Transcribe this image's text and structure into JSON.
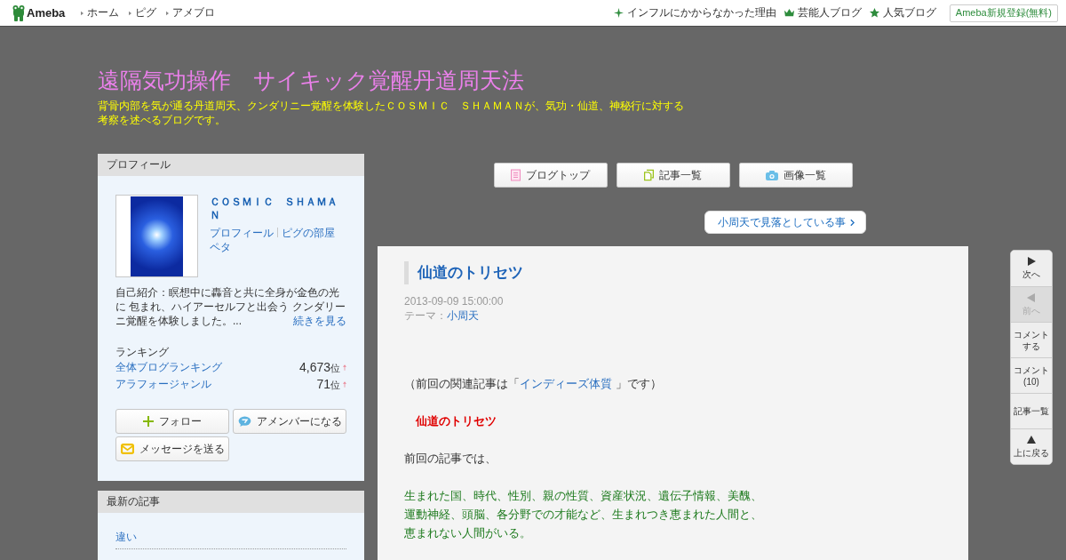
{
  "top_bar": {
    "logo": "Ameba",
    "nav": [
      "ホーム",
      "ピグ",
      "アメブロ"
    ],
    "links": [
      {
        "kind": "sparkle",
        "label": "インフルにかからなかった理由"
      },
      {
        "kind": "crown",
        "label": "芸能人ブログ"
      },
      {
        "kind": "star",
        "label": "人気ブログ"
      }
    ],
    "signup_button": "Ameba新規登録(無料)"
  },
  "blog_header": {
    "title": "遠隔気功操作　サイキック覚醒丹道周天法",
    "description": "背骨内部を気が通る丹道周天、クンダリニー覚醒を体験したＣＯＳＭＩＣ　ＳＨＡＭＡＮが、気功・仙道、神秘行に対する考察を述べるブログです。"
  },
  "profile": {
    "heading": "プロフィール",
    "name": "ＣＯＳＭＩＣ　ＳＨＡＭＡＮ",
    "links": [
      "プロフィール",
      "ピグの部屋",
      "ペタ"
    ],
    "intro": "自己紹介：瞑想中に轟音と共に全身が金色の光に 包まれ、ハイアーセルフと出会う クンダリーニ覚醒を体験しました。...",
    "more_link": "続きを見る",
    "ranking_heading": "ランキング",
    "rankings": [
      {
        "label": "全体ブログランキング",
        "rank": "4,673",
        "unit": "位",
        "rising": true
      },
      {
        "label": "アラフォージャンル",
        "rank": "71",
        "unit": "位",
        "rising": true
      }
    ],
    "buttons": [
      {
        "kind": "follow",
        "label": "フォロー"
      },
      {
        "kind": "amember",
        "label": "アメンバーになる"
      },
      {
        "kind": "message",
        "label": "メッセージを送る"
      }
    ]
  },
  "latest_entries": {
    "heading": "最新の記事",
    "items": [
      "違い"
    ]
  },
  "blog_nav": [
    {
      "kind": "top",
      "label": "ブログトップ"
    },
    {
      "kind": "entries",
      "label": "記事一覧"
    },
    {
      "kind": "images",
      "label": "画像一覧"
    }
  ],
  "next_entry_link": "小周天で見落としている事",
  "article": {
    "title": "仙道のトリセツ",
    "date": "2013-09-09 15:00:00",
    "theme_label": "テーマ：",
    "theme": "小周天",
    "body": [
      {
        "kind": "related",
        "before": "（前回の関連記事は「",
        "link": "インディーズ体質",
        "after": " 」です）"
      },
      {
        "kind": "heading",
        "text": "仙道のトリセツ"
      },
      {
        "kind": "plain",
        "text": "前回の記事では、"
      },
      {
        "kind": "highlight",
        "lines": [
          "生まれた国、時代、性別、親の性質、資産状況、遺伝子情報、美醜、",
          "運動神経、頭脳、各分野での才能など、生まれつき恵まれた人間と、",
          "恵まれない人間がいる。"
        ]
      }
    ]
  },
  "side_nav": [
    {
      "kind": "next",
      "label": "次へ",
      "disabled": false
    },
    {
      "kind": "prev",
      "label": "前へ",
      "disabled": true
    },
    {
      "kind": "comment",
      "label": "コメントする",
      "disabled": false
    },
    {
      "kind": "comments",
      "label": "コメント(10)",
      "disabled": false
    },
    {
      "kind": "list",
      "label": "記事一覧",
      "disabled": false
    },
    {
      "kind": "top",
      "label": "上に戻る",
      "disabled": false
    }
  ]
}
